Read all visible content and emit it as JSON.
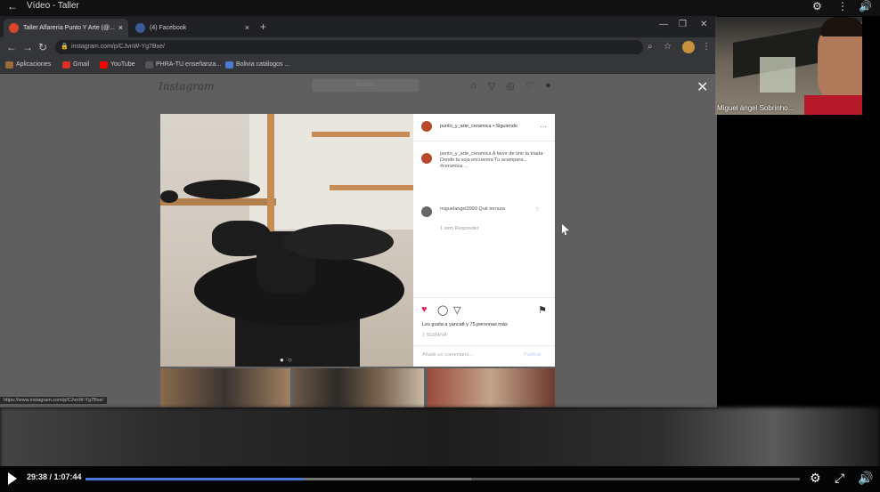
{
  "topbar": {
    "title": "Vídeo - Taller",
    "icons": [
      "settings-icon",
      "more-icon",
      "volume-icon"
    ]
  },
  "browser": {
    "tabs": [
      {
        "label": "Taller Alfarería Punto Y Arte (@...",
        "color": "#d9462a",
        "active": true
      },
      {
        "label": "(4) Facebook",
        "color": "#3b5998",
        "active": false
      }
    ],
    "url": "instagram.com/p/CJvnW-Yg7Bxe/",
    "bookmarks": [
      {
        "label": "Aplicaciones",
        "color": "#9a6b3c"
      },
      {
        "label": "Gmail",
        "color": "#d93025"
      },
      {
        "label": "YouTube",
        "color": "#ff0000"
      },
      {
        "label": "PHRA-TU enseñanza...",
        "color": "#555"
      },
      {
        "label": "Bolivia catálogos ...",
        "color": "#4a7bd0"
      }
    ],
    "status_url": "https://www.instagram.com/p/CJvnW-Yg7Bxe/"
  },
  "instagram": {
    "logo": "Instagram",
    "search_placeholder": "Buscar",
    "post": {
      "username": "punto_y_arte_ceramica • Siguiendo",
      "caption": "punto_y_arte_ceramica A favor de unir la triada: Donde la soja encuentra Tu acampara... #ceramica ...",
      "comment_user": "miguelangel3999 Qué ternura",
      "comment_meta": "1 sem  Responder",
      "likes": "Les gusta a yancatt y 75 personas más",
      "date": "1 SEMANA",
      "add_comment": "Añade un comentario...",
      "publish": "Publicar"
    }
  },
  "webcam": {
    "name": "Miguel ángel Sobrinho..."
  },
  "player": {
    "time": "29:38 / 1:07:44",
    "progress": 0.306,
    "buffered": 0.54
  }
}
